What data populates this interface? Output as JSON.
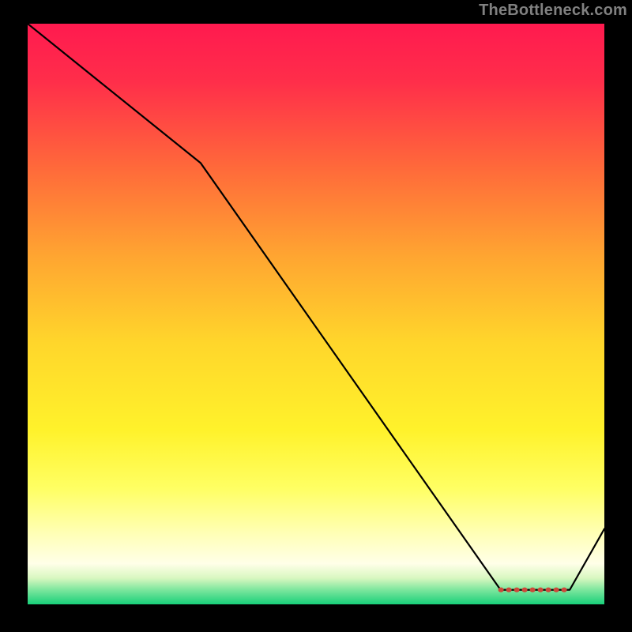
{
  "attribution": "TheBottleneck.com",
  "chart_data": {
    "type": "line",
    "title": "",
    "xlabel": "",
    "ylabel": "",
    "xlim": [
      0,
      100
    ],
    "ylim": [
      0,
      100
    ],
    "line": {
      "x": [
        0,
        30,
        82,
        94,
        100
      ],
      "y": [
        100,
        76,
        2.5,
        2.5,
        13
      ]
    },
    "highlight_segment": {
      "x_start": 82,
      "x_end": 94,
      "y": 2.5
    },
    "gradient_stops": [
      {
        "offset": 0.0,
        "color": "#ff1a4f"
      },
      {
        "offset": 0.1,
        "color": "#ff2e4a"
      },
      {
        "offset": 0.25,
        "color": "#ff6a3a"
      },
      {
        "offset": 0.4,
        "color": "#ffa531"
      },
      {
        "offset": 0.55,
        "color": "#ffd62b"
      },
      {
        "offset": 0.7,
        "color": "#fff22b"
      },
      {
        "offset": 0.8,
        "color": "#ffff63"
      },
      {
        "offset": 0.88,
        "color": "#ffffb8"
      },
      {
        "offset": 0.93,
        "color": "#ffffe8"
      },
      {
        "offset": 0.955,
        "color": "#d8f7c0"
      },
      {
        "offset": 0.975,
        "color": "#7de69d"
      },
      {
        "offset": 1.0,
        "color": "#18d07a"
      }
    ]
  }
}
